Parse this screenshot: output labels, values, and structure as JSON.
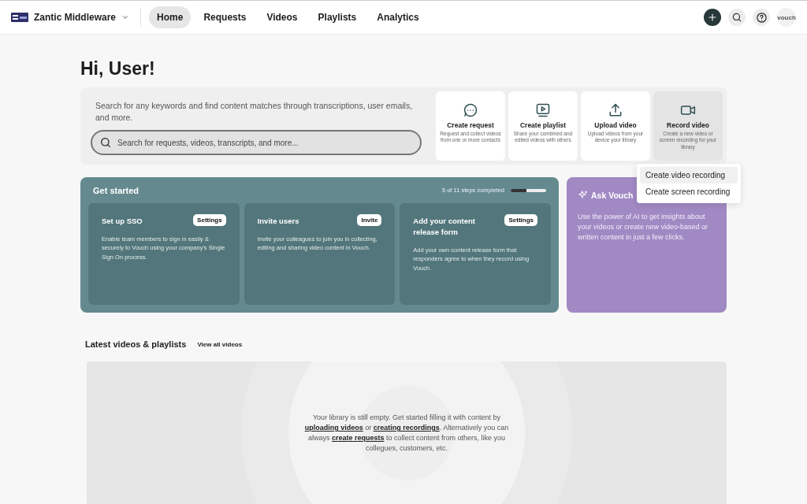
{
  "topbar": {
    "workspace": "Zantic Middleware",
    "nav": [
      {
        "label": "Home",
        "selected": true
      },
      {
        "label": "Requests",
        "selected": false
      },
      {
        "label": "Videos",
        "selected": false
      },
      {
        "label": "Playlists",
        "selected": false
      },
      {
        "label": "Analytics",
        "selected": false
      }
    ],
    "avatar": "vouch"
  },
  "greeting": "Hi, User!",
  "search": {
    "description": "Search for any keywords and find content matches through transcriptions, user emails, and more.",
    "placeholder": "Search for requests, videos, transcripts, and more..."
  },
  "actions": [
    {
      "kind": "request",
      "title": "Create request",
      "description": "Request and collect videos from one or more contacts",
      "selected": false
    },
    {
      "kind": "playlist",
      "title": "Create playlist",
      "description": "Share your combined and edited videos with others",
      "selected": false
    },
    {
      "kind": "upload",
      "title": "Upload video",
      "description": "Upload videos from your device your library",
      "selected": false
    },
    {
      "kind": "record",
      "title": "Record video",
      "description": "Create a new video or screen recording for your library",
      "selected": true
    }
  ],
  "record_menu": [
    {
      "label": "Create video recording",
      "selected": true
    },
    {
      "label": "Create screen recording",
      "selected": false
    }
  ],
  "get_started": {
    "title": "Get started",
    "progress_text": "5 of 11 steps completed",
    "level": 0.45,
    "cards": [
      {
        "title": "Set up SSO",
        "button": "Settings",
        "description": "Enable team members to sign in easily & securely to Vouch using your company's Single Sign On process."
      },
      {
        "title": "Invite users",
        "button": "Invite",
        "description": "Invite your colleagues to join you in collecting, editing and sharing video content in Vouch."
      },
      {
        "title": "Add your content release form",
        "button": "Settings",
        "description": "Add your own content release form that responders agree to when they record using Vouch."
      }
    ]
  },
  "ask_vouch": {
    "title": "Ask Vouch",
    "description": "Use the power of AI to get insights about your videos or create new video-based or written content in just a few clicks."
  },
  "latest": {
    "title": "Latest videos & playlists",
    "link": "View all videos",
    "empty_message": [
      {
        "kind": "text",
        "text": "Your library is still empty. Get started filling it with content by "
      },
      {
        "kind": "link",
        "text": "uploading videos"
      },
      {
        "kind": "text",
        "text": " or "
      },
      {
        "kind": "link",
        "text": "creating recordings"
      },
      {
        "kind": "text",
        "text": ". Alternatively you can always "
      },
      {
        "kind": "link",
        "text": "create requests"
      },
      {
        "kind": "text",
        "text": " to collect content from others, like you collegues, customers, etc."
      }
    ]
  }
}
